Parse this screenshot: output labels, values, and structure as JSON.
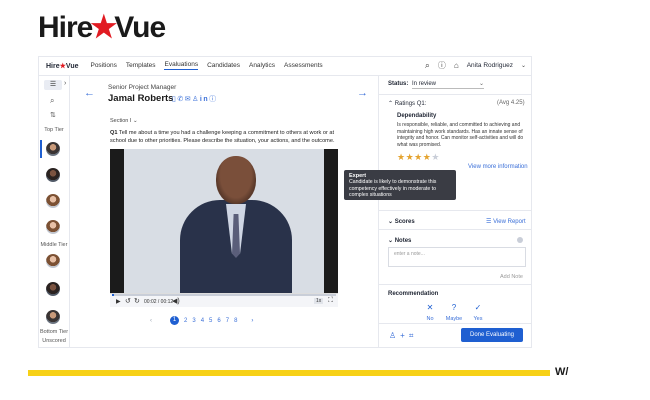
{
  "brand": {
    "logo_left": "Hire",
    "logo_right": "Vue",
    "nav_left": "Hire",
    "nav_right": "Vue",
    "footer_mark": "W/"
  },
  "nav": {
    "items": [
      "Positions",
      "Templates",
      "Evaluations",
      "Candidates",
      "Analytics",
      "Assessments"
    ],
    "active": "Evaluations",
    "user": "Anita Rodriguez"
  },
  "sidebar": {
    "top_tier": "Top Tier",
    "middle_tier": "Middle Tier",
    "bottom_tier": "Bottom Tier",
    "unscored": "Unscored"
  },
  "candidate": {
    "job_title": "Senior Project Manager",
    "name": "Jamal Roberts"
  },
  "question": {
    "section": "Section I",
    "number": "Q1",
    "text": "Tell me about a time you had a challenge keeping a commitment to others at work or at school due to other priorities. Please describe the situation, your actions, and the outcome."
  },
  "video": {
    "time": "00:02 / 00:12",
    "speed": "1x",
    "progress": 0.01
  },
  "pagination": {
    "pages": [
      "1",
      "2",
      "3",
      "4",
      "5",
      "6",
      "7",
      "8"
    ],
    "current": "1",
    "prev": "‹",
    "next": "›"
  },
  "status": {
    "label": "Status:",
    "value": "In review"
  },
  "ratings": {
    "label": "Ratings Q1:",
    "avg": "(Avg 4.25)",
    "competency": "Dependability",
    "description": "Is responsible, reliable, and committed to achieving and maintaining high work standards. Has an innate sense of integrity and honor. Can monitor self-activities and will do what was promised.",
    "stars": 4,
    "stars_max": 5,
    "view_more": "View more information"
  },
  "tooltip": {
    "title": "Expert",
    "text": "Candidate is likely to demonstrate this competency effectively in moderate to complex situations"
  },
  "scores": {
    "label": "Scores",
    "view_report": "View Report"
  },
  "notes": {
    "label": "Notes",
    "placeholder": "enter a note...",
    "add_note": "Add Note"
  },
  "recommendation": {
    "label": "Recommendation",
    "options": [
      {
        "label": "No",
        "glyph": "✕"
      },
      {
        "label": "Maybe",
        "glyph": "?"
      },
      {
        "label": "Yes",
        "glyph": "✓"
      }
    ]
  },
  "actions": {
    "done": "Done Evaluating"
  },
  "colors": {
    "accent": "#1f5fd1",
    "brand_red": "#e11b22",
    "bar_yellow": "#f7d117",
    "star": "#e4a32f"
  }
}
